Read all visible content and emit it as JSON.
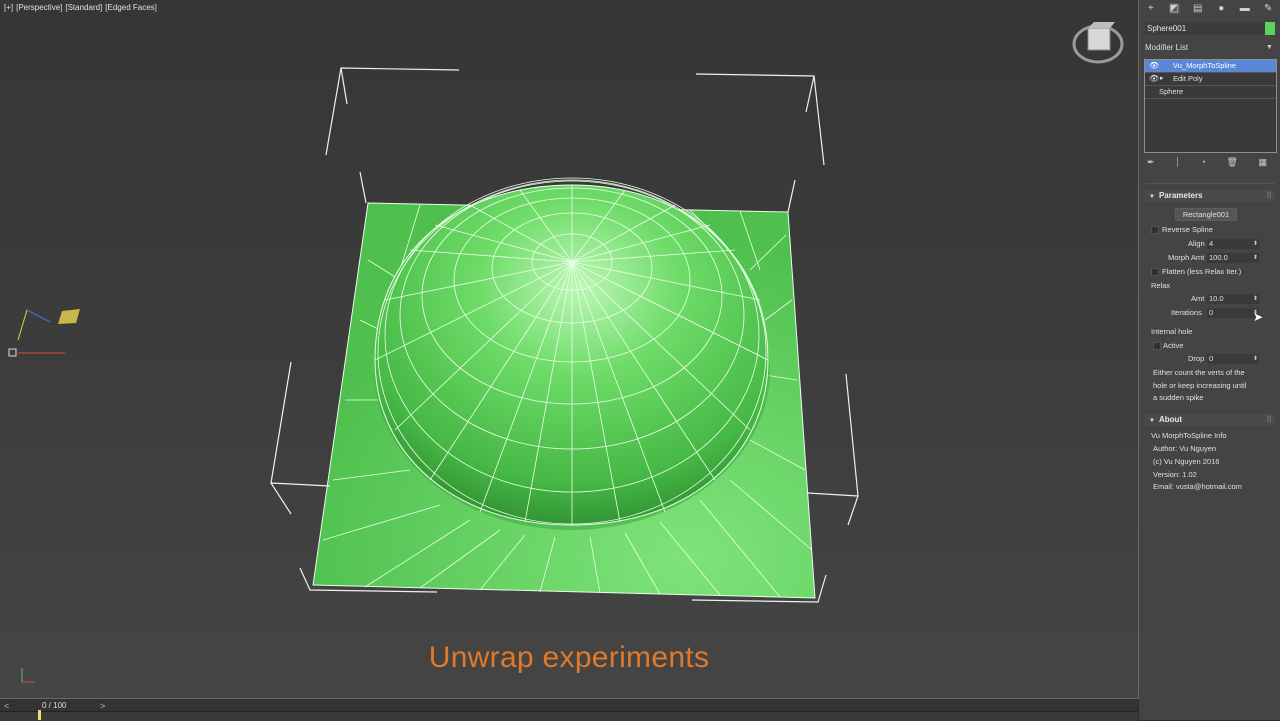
{
  "viewport": {
    "labels": [
      "[+]",
      "[Perspective]",
      "[Standard]",
      "[Edged Faces]"
    ],
    "caption": "Unwrap experiments",
    "axis": {
      "x": "x",
      "y": "y",
      "z": "z"
    }
  },
  "timeline": {
    "frame_counter": "0 / 100",
    "prev": "<",
    "next": ">"
  },
  "panel": {
    "object_name": "Sphere001",
    "object_color": "#5bd35e",
    "modifier_list_label": "Modifier List",
    "stack": [
      {
        "label": "Vu_MorphToSpline",
        "selected": true
      },
      {
        "label": "Edit Poly",
        "selected": false
      },
      {
        "label": "Sphere",
        "selected": false
      }
    ],
    "parameters": {
      "title": "Parameters",
      "pick_button": "Rectangle001",
      "reverse_spline": "Reverse Spline",
      "align_label": "Align",
      "align_value": "4",
      "morph_label": "Morph Amt",
      "morph_value": "100.0",
      "flatten_label": "Flatten (less Relax Iter.)",
      "relax_title": "Relax",
      "amt_label": "Amt",
      "amt_value": "10.0",
      "iterations_label": "Iterations",
      "iterations_value": "0",
      "internal_hole_title": "Internal hole",
      "active_label": "Active",
      "drop_label": "Drop",
      "drop_value": "0",
      "note_line1": "Either count the verts of the",
      "note_line2": "hole or keep increasing until",
      "note_line3": "a sudden spike"
    },
    "about": {
      "title": "About",
      "line1": "Vu MorphToSpline Info",
      "line2": "Author: Vu Nguyen",
      "line3": "(c) Vu Nguyen 2016",
      "line4": "Version: 1.02",
      "line5": "Email: vusta@hotmail.com"
    }
  }
}
